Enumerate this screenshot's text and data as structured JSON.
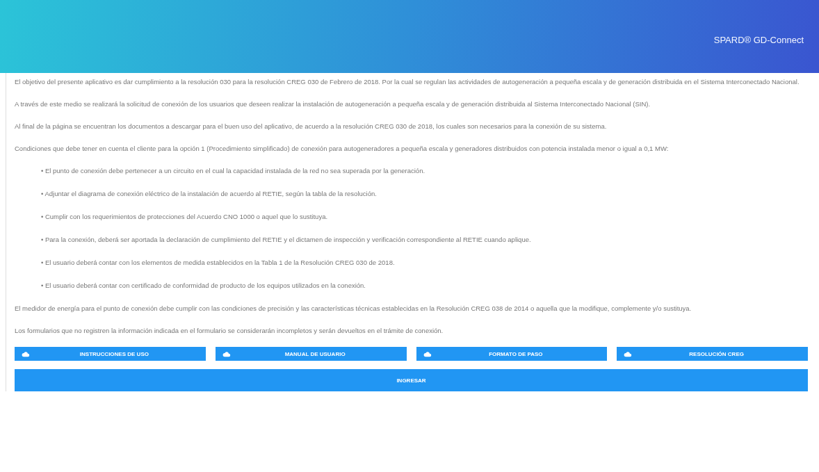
{
  "header": {
    "title": "SPARD® GD-Connect"
  },
  "paragraphs": [
    "El objetivo del presente aplicativo es dar cumplimiento a la resolución 030 para la resolución CREG 030 de Febrero de 2018. Por la cual se regulan las actividades de autogeneración a pequeña escala y de generación distribuida en el Sistema Interconectado Nacional.",
    "A través de este medio se realizará la solicitud de conexión de los usuarios que deseen realizar la instalación de autogeneración a pequeña escala y de generación distribuida al Sistema Interconectado Nacional (SIN).",
    "Al final de la página se encuentran los documentos a descargar para el buen uso del aplicativo, de acuerdo a la resolución CREG 030 de 2018, los cuales son necesarios para la conexión de su sistema.",
    "Condiciones que debe tener en cuenta el cliente para la opción 1 (Procedimiento simplificado) de conexión para autogeneradores a pequeña escala y generadores distribuidos con potencia instalada menor o igual a 0,1 MW:"
  ],
  "conditions": [
    "• El punto de conexión debe pertenecer a un circuito en el cual la capacidad instalada de la red no sea superada por la generación.",
    "• Adjuntar el diagrama de conexión eléctrico de la instalación de acuerdo al RETIE, según la tabla de la resolución.",
    "• Cumplir con los requerimientos de protecciones del Acuerdo CNO 1000 o aquel que lo sustituya.",
    "• Para la conexión, deberá ser aportada la declaración de cumplimiento del RETIE y el dictamen de inspección y verificación correspondiente al RETIE cuando aplique.",
    "• El usuario deberá contar con los elementos de medida establecidos en la Tabla 1 de la Resolución CREG 030 de 2018.",
    "• El usuario deberá contar con certificado de conformidad de producto de los equipos utilizados en la conexión."
  ],
  "closing": [
    "El medidor de energía para el punto de conexión debe cumplir con las condiciones de precisión y las características técnicas establecidas en la Resolución CREG 038 de 2014 o aquella que la modifique, complemente y/o sustituya.",
    "Los formularios que no registren la información indicada en el formulario se considerarán incompletos y serán devueltos en el trámite de conexión."
  ],
  "downloads": [
    "INSTRUCCIONES DE USO",
    "MANUAL DE USUARIO",
    "FORMATO DE PASO",
    "RESOLUCIÓN CREG"
  ],
  "enter_button": "INGRESAR"
}
